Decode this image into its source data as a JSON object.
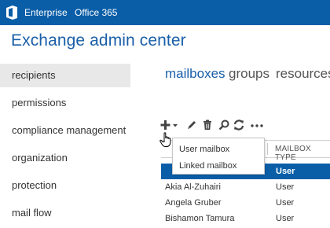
{
  "topbar": {
    "logo_icon": "office-logo-icon",
    "links": [
      {
        "label": "Enterprise"
      },
      {
        "label": "Office 365"
      }
    ],
    "background": "#0a5ea8"
  },
  "app": {
    "title": "Exchange admin center",
    "accent": "#1a5fa8"
  },
  "nav": {
    "items": [
      {
        "label": "recipients",
        "selected": true
      },
      {
        "label": "permissions"
      },
      {
        "label": "compliance management"
      },
      {
        "label": "organization"
      },
      {
        "label": "protection"
      },
      {
        "label": "mail flow"
      }
    ]
  },
  "tabs": [
    {
      "label": "mailboxes",
      "active": true
    },
    {
      "label": "groups"
    },
    {
      "label": "resources"
    }
  ],
  "toolbar": {
    "icons": [
      "add-icon",
      "chevron-down-icon",
      "edit-icon",
      "delete-icon",
      "search-icon",
      "refresh-icon",
      "more-icon"
    ]
  },
  "dropdown": {
    "items": [
      {
        "label": "User mailbox"
      },
      {
        "label": "Linked mailbox"
      }
    ]
  },
  "table": {
    "columns": [
      "MAILBOX TYPE"
    ],
    "selected_row": {
      "type": "User"
    },
    "rows": [
      {
        "name": "Akia Al-Zuhairi",
        "type": "User"
      },
      {
        "name": "Angela Gruber",
        "type": "User"
      },
      {
        "name": "Bishamon Tamura",
        "type": "User"
      }
    ]
  }
}
